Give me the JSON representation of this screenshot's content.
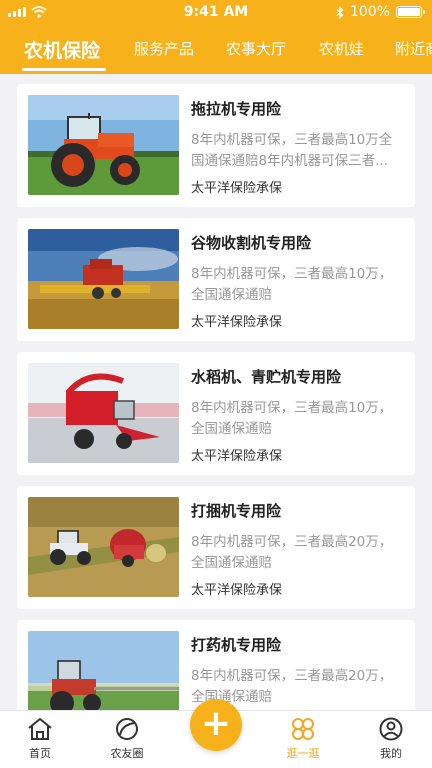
{
  "status_bar": {
    "time": "9:41 AM",
    "battery": "100%"
  },
  "tabs": [
    {
      "label": "农机保险",
      "active": true
    },
    {
      "label": "服务产品",
      "active": false
    },
    {
      "label": "农事大厅",
      "active": false
    },
    {
      "label": "农机娃",
      "active": false
    },
    {
      "label": "附近商",
      "active": false
    }
  ],
  "products": [
    {
      "title": "拖拉机专用险",
      "description": "8年内机器可保，三者最高10万全国通保通赔8年内机器可保三者...",
      "insurer": "太平洋保险承保",
      "image": "tractor-photo"
    },
    {
      "title": "谷物收割机专用险",
      "description": "8年内机器可保，三者最高10万，全国通保通赔",
      "insurer": "太平洋保险承保",
      "image": "harvester-photo"
    },
    {
      "title": "水稻机、青贮机专用险",
      "description": "8年内机器可保，三者最高10万，全国通保通赔",
      "insurer": "太平洋保险承保",
      "image": "forage-harvester-photo"
    },
    {
      "title": "打捆机专用险",
      "description": "8年内机器可保，三者最高20万，全国通保通赔",
      "insurer": "太平洋保险承保",
      "image": "baler-photo"
    },
    {
      "title": "打药机专用险",
      "description": "8年内机器可保，三者最高20万，全国通保通赔",
      "insurer": "",
      "image": "sprayer-photo"
    }
  ],
  "bottom_nav": {
    "home": {
      "label": "首页",
      "icon": "home-icon"
    },
    "friends": {
      "label": "农友圈",
      "icon": "leaf-icon"
    },
    "add": {
      "label": "+",
      "icon": "plus-icon"
    },
    "browse": {
      "label": "逛一逛",
      "icon": "clover-icon",
      "active": true
    },
    "mine": {
      "label": "我的",
      "icon": "user-icon"
    }
  },
  "colors": {
    "brand": "#f7b21b",
    "active_nav": "#f5a623",
    "text_muted": "#999999"
  }
}
